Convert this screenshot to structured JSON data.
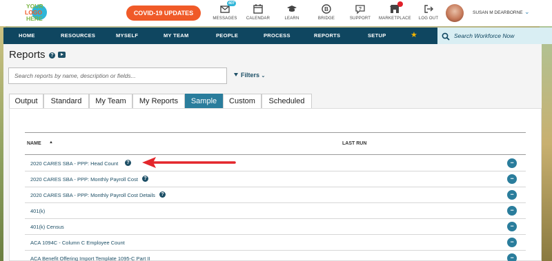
{
  "logo": {
    "line1": "YOUR",
    "line2": "LOGO",
    "line3": "HERE"
  },
  "covid_button": "COVID-19 UPDATES",
  "top_nav": [
    {
      "label": "MESSAGES",
      "icon": "messages-icon",
      "badge": "407"
    },
    {
      "label": "CALENDAR",
      "icon": "calendar-icon"
    },
    {
      "label": "LEARN",
      "icon": "graduation-cap-icon"
    },
    {
      "label": "BRIDGE",
      "icon": "bridge-icon"
    },
    {
      "label": "SUPPORT",
      "icon": "support-icon"
    },
    {
      "label": "MARKETPLACE",
      "icon": "marketplace-icon"
    },
    {
      "label": "LOG OUT",
      "icon": "logout-icon"
    }
  ],
  "user": {
    "name": "SUSAN M DEARBORNE"
  },
  "main_nav": [
    "HOME",
    "RESOURCES",
    "MYSELF",
    "MY TEAM",
    "PEOPLE",
    "PROCESS",
    "REPORTS",
    "SETUP"
  ],
  "nav_search_placeholder": "Search Workforce Now",
  "page": {
    "title": "Reports"
  },
  "search": {
    "placeholder": "Search reports by name, description or fields...",
    "value": ""
  },
  "filters_label": "Filters",
  "tabs": [
    {
      "label": "Output"
    },
    {
      "label": "Standard"
    },
    {
      "label": "My Team"
    },
    {
      "label": "My Reports"
    },
    {
      "label": "Sample",
      "active": true
    },
    {
      "label": "Custom"
    },
    {
      "label": "Scheduled"
    }
  ],
  "table": {
    "columns": [
      "NAME",
      "LAST RUN"
    ],
    "sort": "ascending",
    "rows": [
      {
        "name": "2020 CARES SBA - PPP: Head Count",
        "help": true
      },
      {
        "name": "2020 CARES SBA - PPP: Monthly Payroll Cost",
        "help": true
      },
      {
        "name": "2020 CARES SBA - PPP: Monthly Payroll Cost Details",
        "help": true
      },
      {
        "name": "401(k)",
        "help": false
      },
      {
        "name": "401(k) Census",
        "help": false
      },
      {
        "name": "ACA 1094C - Column C Employee Count",
        "help": false
      },
      {
        "name": "ACA Benefit Offering Import Template 1095-C Part II",
        "help": false
      }
    ]
  },
  "colors": {
    "nav": "#0f4660",
    "accent": "#2a7d9c",
    "covid": "#f05a28",
    "arrow": "#e3262b"
  }
}
